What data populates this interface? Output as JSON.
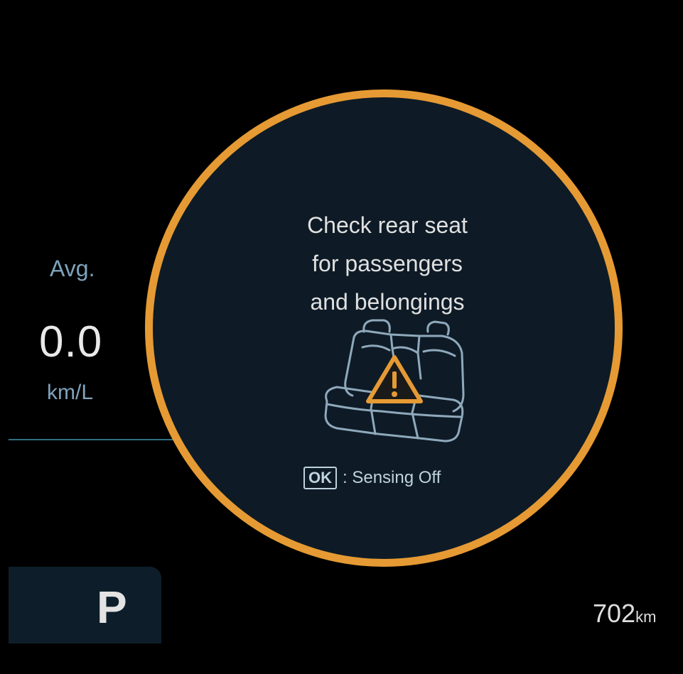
{
  "trip": {
    "avg_label": "Avg.",
    "avg_value": "0.0",
    "avg_unit": "km/L"
  },
  "gear": {
    "position": "P"
  },
  "range": {
    "value": "702",
    "unit": "km"
  },
  "alert": {
    "line1": "Check rear seat",
    "line2": "for passengers",
    "line3": "and belongings",
    "ok_key": "OK",
    "ok_action": ": Sensing Off",
    "icon": "rear-seat-warning-icon",
    "accent_color": "#e69a34"
  }
}
